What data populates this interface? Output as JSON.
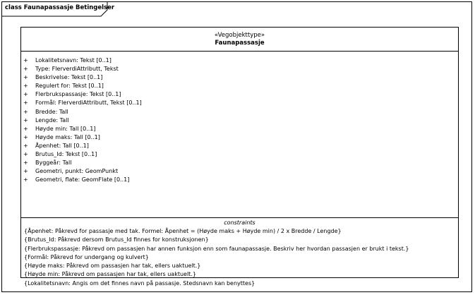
{
  "diagram": {
    "frame_title": "class Faunapassasje Betingelser",
    "class": {
      "stereotype": "«Vegobjekttype»",
      "name": "Faunapassasje",
      "attributes": [
        {
          "visibility": "+",
          "text": "Lokalitetsnavn: Tekst [0..1]"
        },
        {
          "visibility": "+",
          "text": "Type: FlerverdiAttributt, Tekst"
        },
        {
          "visibility": "+",
          "text": "Beskrivelse: Tekst [0..1]"
        },
        {
          "visibility": "+",
          "text": "Regulert for: Tekst [0..1]"
        },
        {
          "visibility": "+",
          "text": "Flerbrukspassasje: Tekst [0..1]"
        },
        {
          "visibility": "+",
          "text": "Formål: FlerverdiAttributt, Tekst [0..1]"
        },
        {
          "visibility": "+",
          "text": "Bredde: Tall"
        },
        {
          "visibility": "+",
          "text": "Lengde: Tall"
        },
        {
          "visibility": "+",
          "text": "Høyde min: Tall [0..1]"
        },
        {
          "visibility": "+",
          "text": "Høyde maks: Tall [0..1]"
        },
        {
          "visibility": "+",
          "text": "Åpenhet: Tall [0..1]"
        },
        {
          "visibility": "+",
          "text": "Brutus_Id: Tekst [0..1]"
        },
        {
          "visibility": "+",
          "text": "Byggeår: Tall"
        },
        {
          "visibility": "+",
          "text": "Geometri, punkt: GeomPunkt"
        },
        {
          "visibility": "+",
          "text": "Geometri, flate: GeomFlate [0..1]"
        }
      ],
      "constraints_header": "constraints",
      "constraints": [
        "{Åpenhet: Påkrevd for passasje med tak. Formel: Åpenhet = (Høyde maks + Høyde min) / 2 x Bredde / Lengde}",
        "{Brutus_Id: Påkrevd dersom Brutus_Id finnes for konstruksjonen}",
        "{Flerbrukspassasje: Påkrevd om passasjen har annen funksjon enn som faunapassasje. Beskriv her hvordan passasjen er brukt i tekst.}",
        "{Formål: Påkrevd for undergang og kulvert}",
        "{Høyde maks: Påkrevd om passasjen har tak, ellers uaktuelt.}",
        "{Høyde min: Påkrevd om passasjen har tak, ellers uaktuelt.}",
        "{Lokalitetsnavn: Angis om det finnes navn på passasje. Stedsnavn kan benyttes}"
      ]
    }
  }
}
